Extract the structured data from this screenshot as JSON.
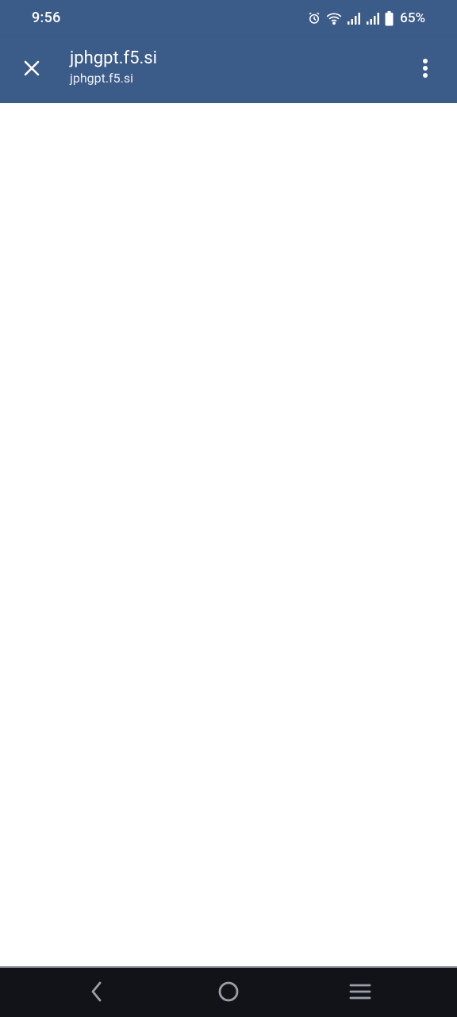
{
  "status_bar": {
    "time": "9:56",
    "battery_percent": "65%",
    "icons": [
      "alarm-icon",
      "wifi-icon",
      "signal-icon",
      "signal-icon",
      "battery-icon"
    ]
  },
  "toolbar": {
    "title": "jphgpt.f5.si",
    "url": "jphgpt.f5.si",
    "close_icon": "close-icon",
    "menu_icon": "more-vert-icon"
  },
  "nav_bar": {
    "icons": [
      "back-icon",
      "home-icon",
      "recents-icon"
    ]
  },
  "colors": {
    "toolbar_bg": "#3b5b88",
    "nav_bg": "#111318",
    "content_bg": "#ffffff"
  }
}
